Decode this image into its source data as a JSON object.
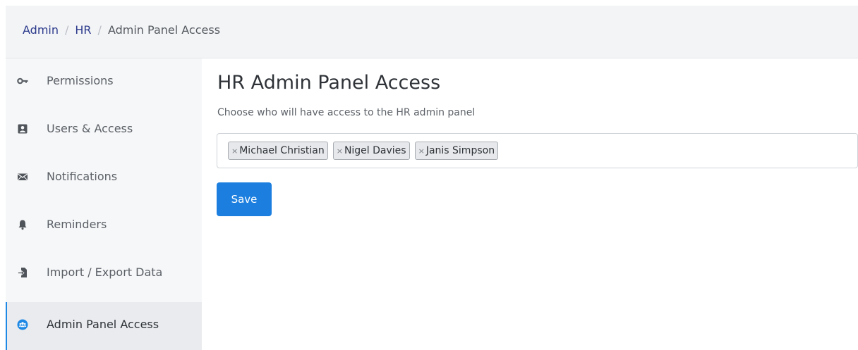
{
  "breadcrumb": {
    "items": [
      "Admin",
      "HR"
    ],
    "separator": "/",
    "current": "Admin Panel Access"
  },
  "sidebar": {
    "items": [
      {
        "label": "Permissions",
        "icon": "key-icon"
      },
      {
        "label": "Users & Access",
        "icon": "user-card-icon"
      },
      {
        "label": "Notifications",
        "icon": "envelope-icon"
      },
      {
        "label": "Reminders",
        "icon": "bell-icon"
      },
      {
        "label": "Import / Export Data",
        "icon": "file-import-icon"
      },
      {
        "label": "Admin Panel Access",
        "icon": "users-circle-icon",
        "active": true
      }
    ]
  },
  "main": {
    "title": "HR Admin Panel Access",
    "description": "Choose who will have access to the HR admin panel",
    "tag_remove_symbol": "×",
    "selected_users": [
      "Michael Christian",
      "Nigel Davies",
      "Janis Simpson"
    ],
    "save_label": "Save"
  },
  "colors": {
    "accent": "#1c7fe0",
    "breadcrumb_link": "#2b3a8c",
    "active_border": "#1e88e5",
    "sidebar_bg": "#f6f7f8",
    "topbar_bg": "#f3f4f6"
  }
}
